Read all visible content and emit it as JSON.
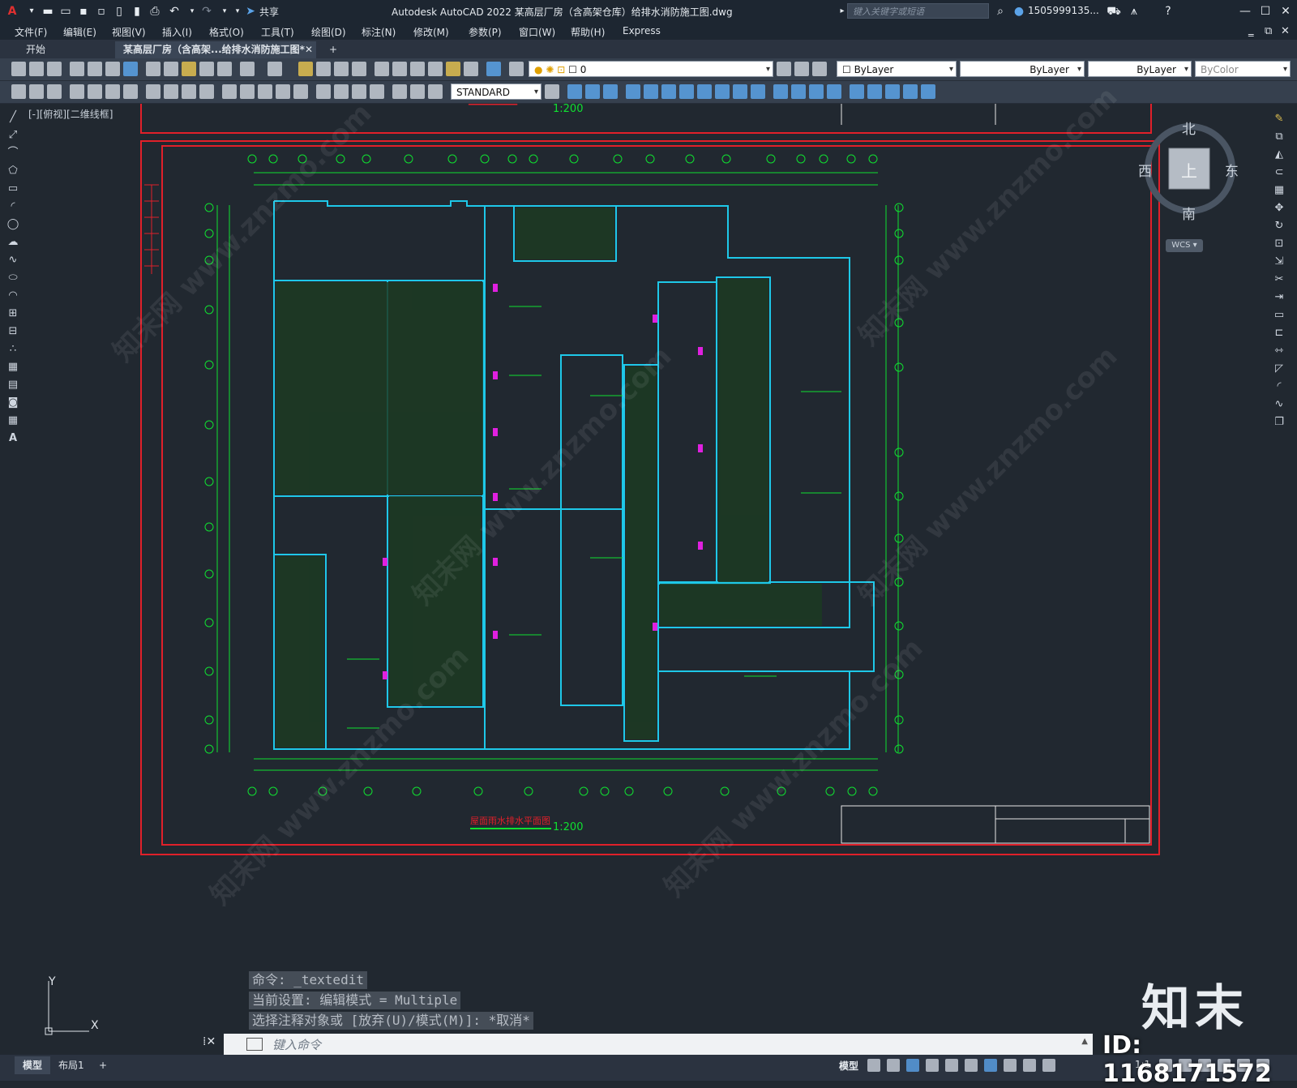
{
  "titlebar": {
    "app_title": "Autodesk AutoCAD 2022    某高层厂房（含高架仓库）给排水消防施工图.dwg",
    "share_label": "共享",
    "search_placeholder": "键入关键字或短语",
    "user_name": "1505999135...",
    "app_logo": "A"
  },
  "menu": [
    "文件(F)",
    "编辑(E)",
    "视图(V)",
    "插入(I)",
    "格式(O)",
    "工具(T)",
    "绘图(D)",
    "标注(N)",
    "修改(M)",
    "参数(P)",
    "窗口(W)",
    "帮助(H)",
    "Express"
  ],
  "tabs": {
    "start": "开始",
    "active_doc": "某高层厂房（含高架...给排水消防施工图*",
    "add": "+"
  },
  "toolbar": {
    "layer_value": "0",
    "color_combo": "ByLayer",
    "linetype_combo": "ByLayer",
    "lineweight_combo": "ByLayer",
    "plotstyle_combo": "ByColor",
    "textstyle_combo": "STANDARD"
  },
  "view_label": "[-][俯视][二维线框]",
  "viewcube": {
    "north": "北",
    "south": "南",
    "east": "东",
    "west": "西",
    "top": "上",
    "wcs": "WCS"
  },
  "drawing": {
    "top_scale": "1:200",
    "bottom_title": "屋面雨水排水平面图",
    "bottom_scale": "1:200"
  },
  "command": {
    "line1": "命令: _textedit",
    "line2": "当前设置: 编辑模式 = Multiple",
    "line3": "选择注释对象或 [放弃(U)/模式(M)]: *取消*",
    "placeholder": "键入命令"
  },
  "layout_tabs": [
    "模型",
    "布局1",
    "+"
  ],
  "statusbar": {
    "model": "模型",
    "scale": "1:1"
  },
  "ucs": {
    "x": "X",
    "y": "Y"
  },
  "watermark": {
    "text": "知末网 www.znzmo.com",
    "brand": "知末",
    "image_id": "ID: 1168171572"
  }
}
